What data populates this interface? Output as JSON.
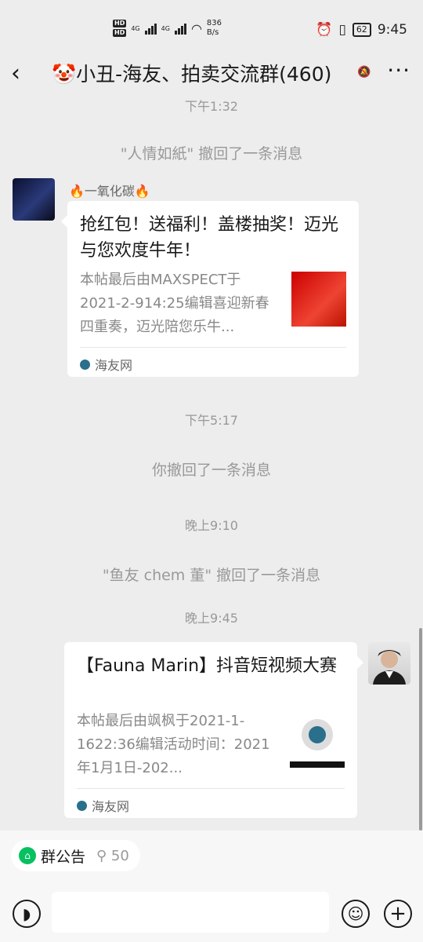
{
  "status_bar": {
    "hd1": "HD",
    "hd2": "HD",
    "net1": "4G",
    "net2": "4G",
    "speed_value": "836",
    "speed_unit": "B/s",
    "battery": "62",
    "time": "9:45"
  },
  "header": {
    "back_icon": "‹",
    "title": "🤡小丑-海友、拍卖交流群(460)",
    "more_icon": "···"
  },
  "chat": {
    "top_time": "下午1:32",
    "recall_1": "\"人情如紙\" 撤回了一条消息",
    "message_1": {
      "sender": "🔥一氧化碳🔥",
      "title": "抢红包！送福利！盖楼抽奖！迈光与您欢度牛年！",
      "desc": "本帖最后由MAXSPECT于2021-2-914:25编辑喜迎新春四重奏，迈光陪您乐牛...",
      "source": "海友网"
    },
    "time_2": "下午5:17",
    "recall_2": "你撤回了一条消息",
    "time_3": "晚上9:10",
    "recall_3": "\"鱼友 chem 董\" 撤回了一条消息",
    "time_4": "晚上9:45",
    "message_2": {
      "title": "【Fauna Marin】抖音短视频大赛",
      "desc": "本帖最后由飒枫于2021-1-1622:36编辑活动时间：2021年1月1日-202...",
      "source": "海友网"
    }
  },
  "bottom": {
    "notice_label": "群公告",
    "notice_count": "50"
  }
}
